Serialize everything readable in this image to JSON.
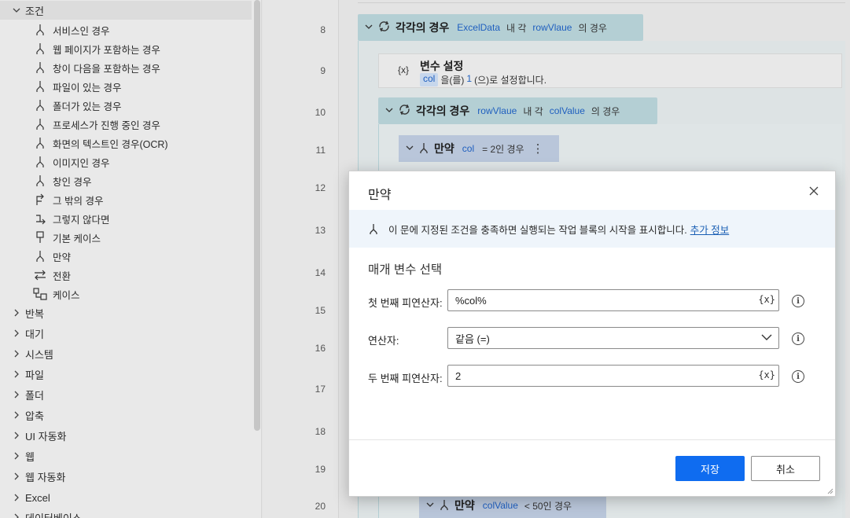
{
  "sidebar": {
    "conditions_group": "조건",
    "condition_actions": [
      {
        "label": "서비스인 경우",
        "icon": "branch-icon"
      },
      {
        "label": "웹 페이지가 포함하는 경우",
        "icon": "branch-icon"
      },
      {
        "label": "창이 다음을 포함하는 경우",
        "icon": "branch-icon"
      },
      {
        "label": "파일이 있는 경우",
        "icon": "branch-icon"
      },
      {
        "label": "폴더가 있는 경우",
        "icon": "branch-icon"
      },
      {
        "label": "프로세스가 진행 중인 경우",
        "icon": "branch-icon"
      },
      {
        "label": "화면의 텍스트인 경우(OCR)",
        "icon": "branch-icon"
      },
      {
        "label": "이미지인 경우",
        "icon": "branch-icon"
      },
      {
        "label": "창인 경우",
        "icon": "branch-icon"
      },
      {
        "label": "그 밖의 경우",
        "icon": "else-if-icon"
      },
      {
        "label": "그렇지 않다면",
        "icon": "else-icon"
      },
      {
        "label": "기본 케이스",
        "icon": "default-case-icon"
      },
      {
        "label": "만약",
        "icon": "branch-icon"
      },
      {
        "label": "전환",
        "icon": "switch-icon"
      },
      {
        "label": "케이스",
        "icon": "case-icon"
      }
    ],
    "groups": [
      "반복",
      "대기",
      "시스템",
      "파일",
      "폴더",
      "압축",
      "UI 자동화",
      "웹",
      "웹 자동화",
      "Excel",
      "데이터베이스"
    ]
  },
  "line_numbers": [
    "8",
    "9",
    "10",
    "11",
    "12",
    "13",
    "14",
    "15",
    "16",
    "17",
    "18",
    "19",
    "20"
  ],
  "flow": {
    "loop1": {
      "title": "각각의 경우",
      "collection": "ExcelData",
      "in_each": "내 각",
      "item": "rowVlaue",
      "suffix": "의 경우"
    },
    "set_var": {
      "title": "변수 설정",
      "var": "col",
      "text_mid": "을(를)",
      "value": "1",
      "text_end": "(으)로 설정합니다.",
      "icon_text": "{x}"
    },
    "loop2": {
      "title": "각각의 경우",
      "collection": "rowVlaue",
      "in_each": "내 각",
      "item": "colValue",
      "suffix": "의 경우"
    },
    "if1": {
      "title": "만약",
      "var": "col",
      "text": "= 2인 경우",
      "more": "⋮"
    },
    "if2": {
      "title": "만약",
      "var": "colValue",
      "text": "< 50인 경우"
    }
  },
  "dialog": {
    "title": "만약",
    "info_text": "이 문에 지정된 조건을 충족하면 실행되는 작업 블록의 시작을 표시합니다.",
    "info_link": "추가 정보",
    "section_title": "매개 변수 선택",
    "first_operand_label": "첫 번째 피연산자:",
    "first_operand_value": "%col%",
    "operator_label": "연산자:",
    "operator_value": "같음 (=)",
    "second_operand_label": "두 번째 피연산자:",
    "second_operand_value": "2",
    "var_button": "{x}",
    "info_glyph": "i",
    "save": "저장",
    "cancel": "취소"
  }
}
